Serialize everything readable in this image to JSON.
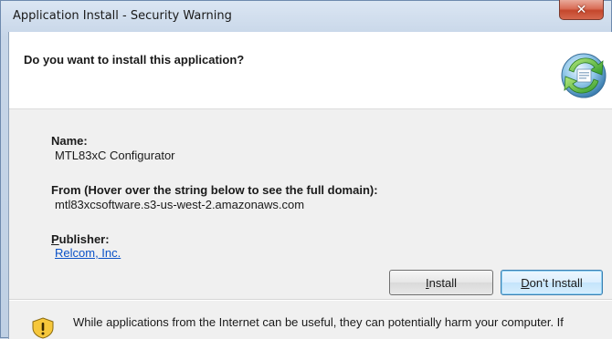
{
  "window": {
    "title": "Application Install - Security Warning",
    "close_symbol": "✕"
  },
  "header": {
    "question": "Do you want to install this application?",
    "icon": "application-install-icon"
  },
  "details": {
    "name_label": "Name:",
    "name_value": "MTL83xC Configurator",
    "from_label": "From (Hover over the string below to see the full domain):",
    "from_value": "mtl83xcsoftware.s3-us-west-2.amazonaws.com",
    "publisher_label_u": "P",
    "publisher_label_rest": "ublisher:",
    "publisher_value": "Relcom, Inc."
  },
  "buttons": {
    "install_u": "I",
    "install_rest": "nstall",
    "dont_install_u": "D",
    "dont_install_rest": "on't Install"
  },
  "footer": {
    "warning_icon": "warning-shield-icon",
    "warning_text": "While applications from the Internet can be useful, they can potentially harm your computer. If"
  },
  "colors": {
    "link": "#0b52c7",
    "close_button": "#c4472c",
    "default_button_border": "#3c7fb1"
  }
}
